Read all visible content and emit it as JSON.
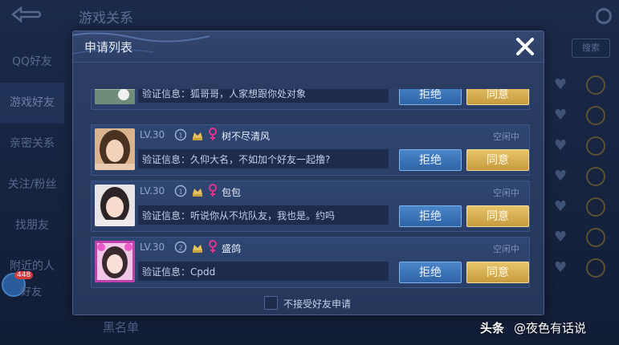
{
  "background": {
    "title": "游戏关系",
    "sidebar": [
      "QQ好友",
      "游戏好友",
      "亲密关系",
      "关注/粉丝",
      "找朋友",
      "附近的人"
    ],
    "badge_count": "448",
    "friend_item": "好友",
    "search_label": "搜索",
    "blacklist_label": "黑名单"
  },
  "dialog": {
    "title": "申请列表",
    "close_icon": "close-icon",
    "reject_label": "拒绝",
    "accept_label": "同意",
    "verify_prefix": "验证信息：",
    "requests": [
      {
        "level": "",
        "nickname": "",
        "status": "",
        "message": "狐哥哥，人家想跟你处对象"
      },
      {
        "level": "LV.30",
        "nickname": "树不尽清风",
        "status": "空闲中",
        "message": "久仰大名，不如加个好友一起撸?"
      },
      {
        "level": "LV.30",
        "nickname": "包包",
        "status": "空闲中",
        "message": "听说你从不坑队友，我也是。约吗"
      },
      {
        "level": "LV.30",
        "nickname": "盛鸽",
        "status": "空闲中",
        "message": "Cpdd"
      }
    ],
    "footer_checkbox_label": "不接受好友申请"
  },
  "watermark": {
    "brand": "头条",
    "account": "@夜色有话说"
  },
  "colors": {
    "reject_button": "#3a73b8",
    "accept_button": "#d8b154",
    "female_icon": "#e0358f"
  }
}
